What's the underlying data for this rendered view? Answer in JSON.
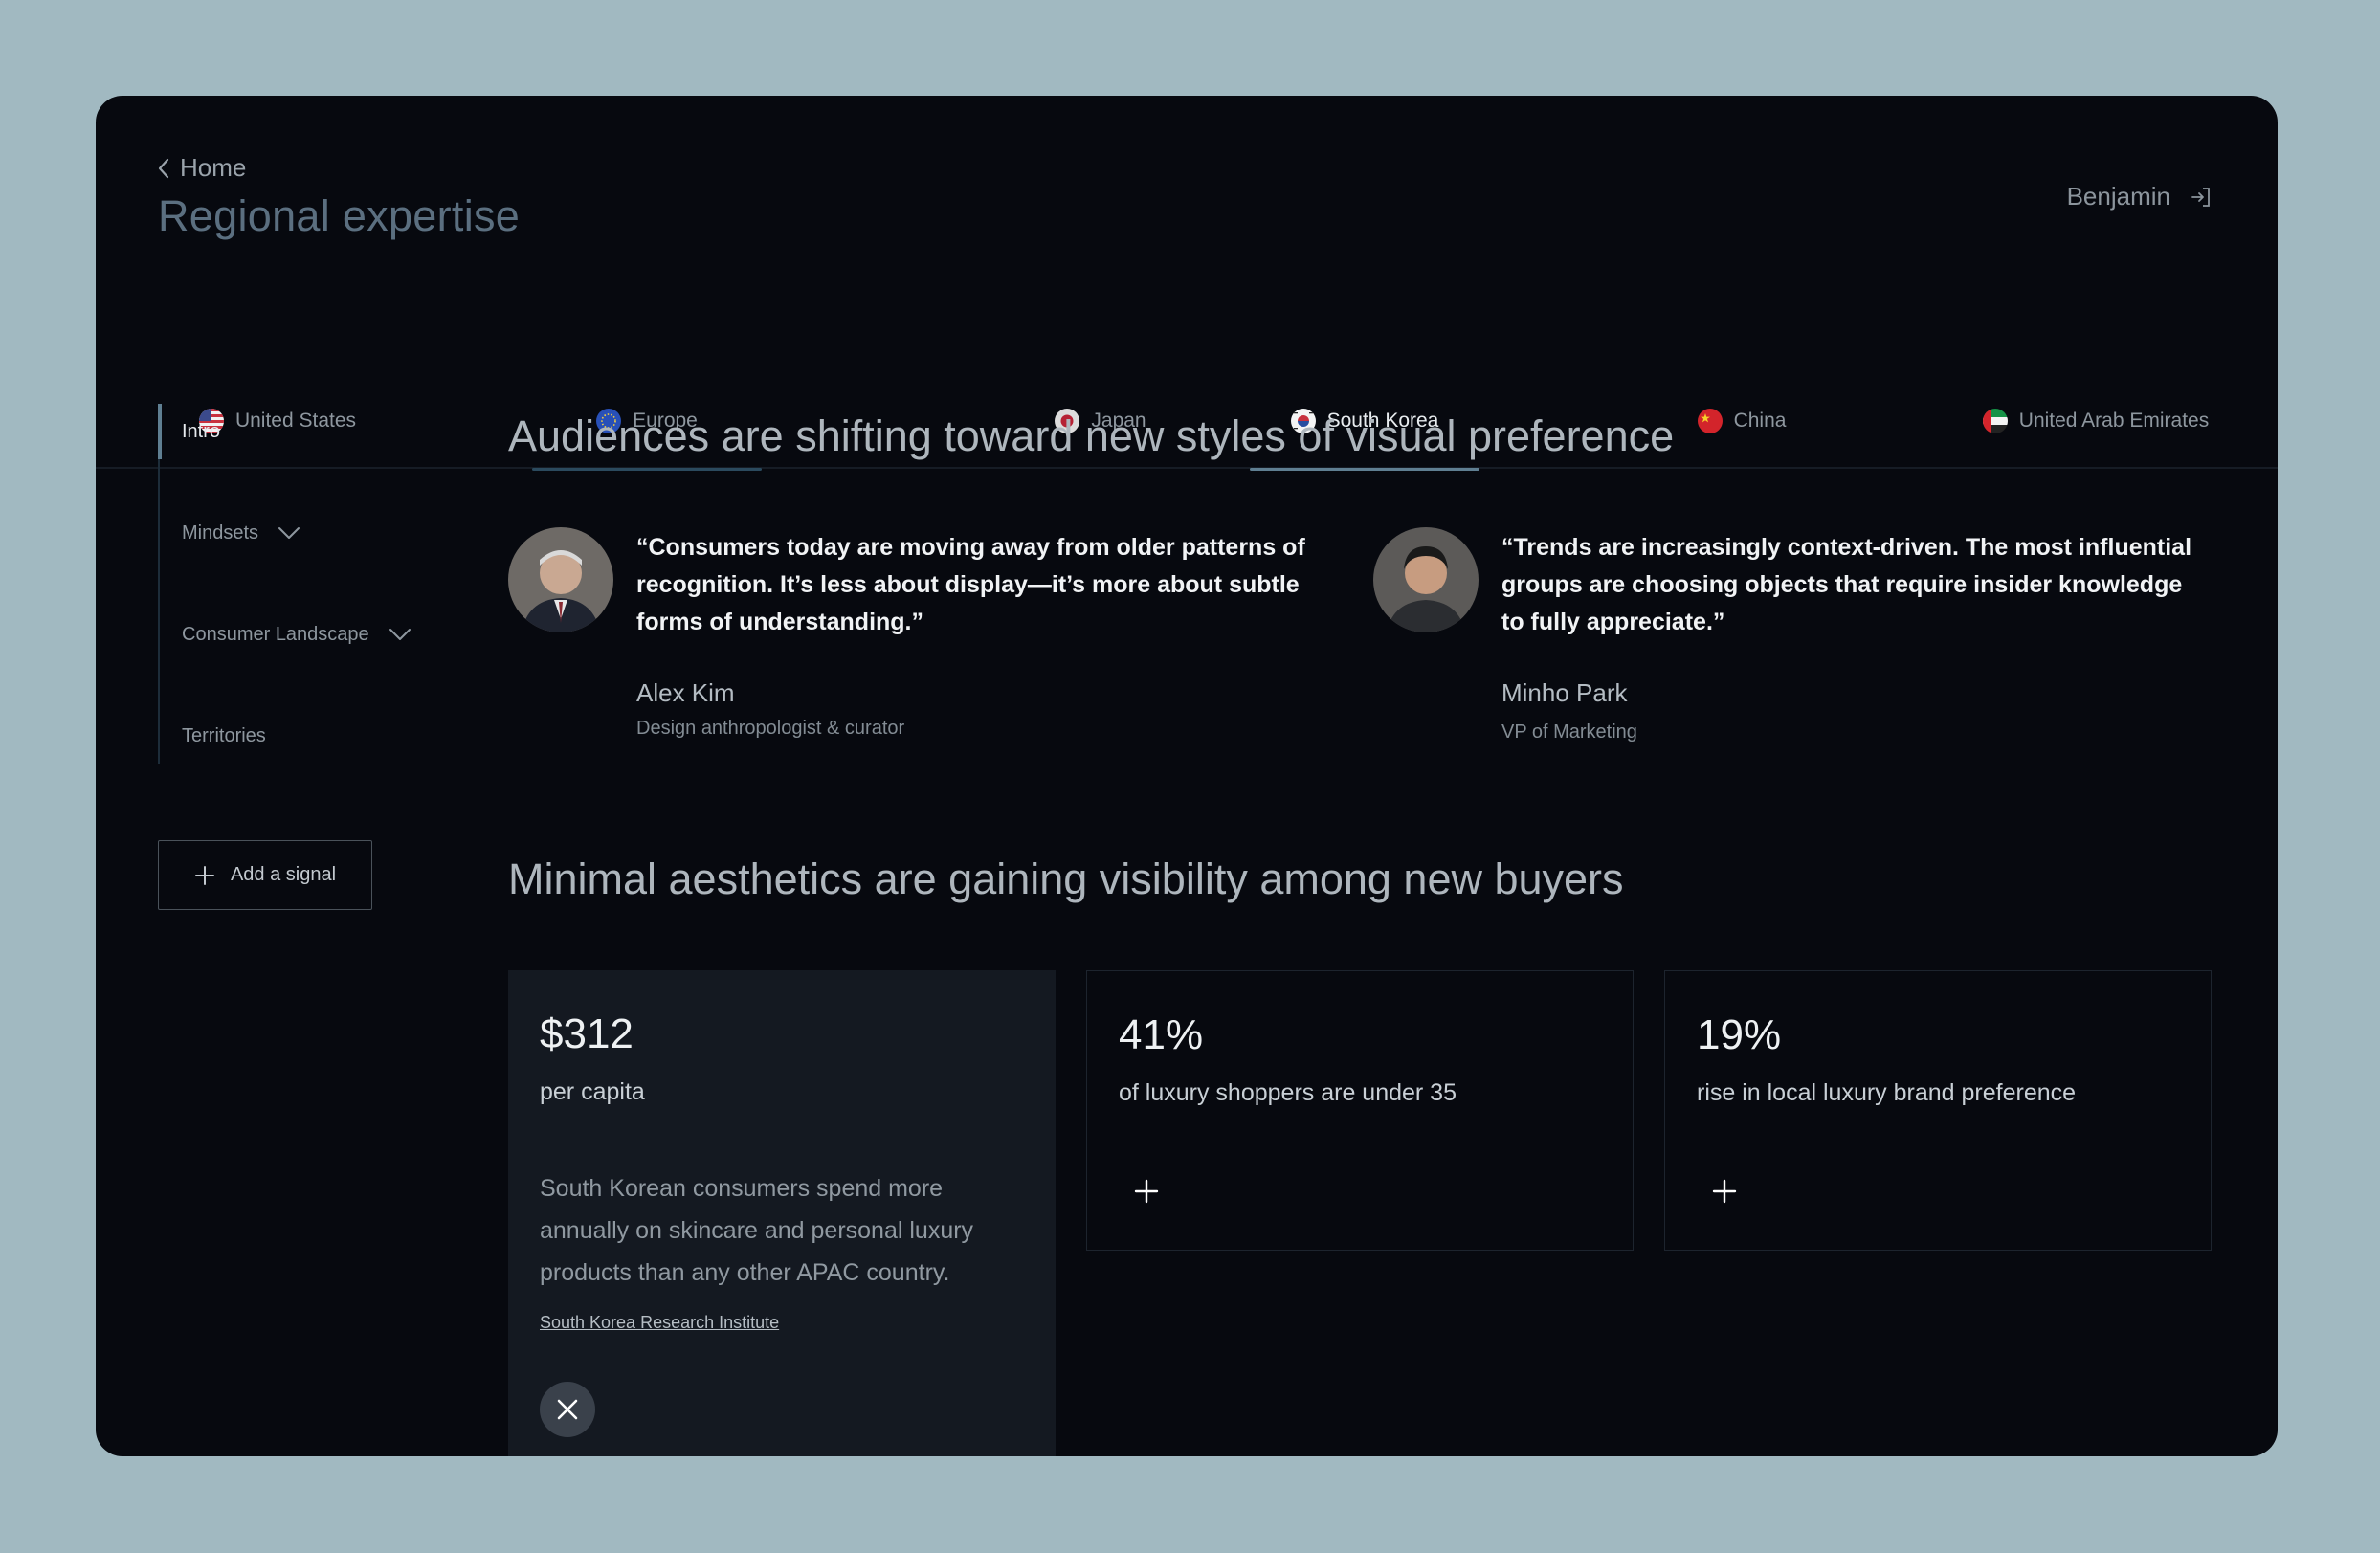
{
  "header": {
    "back_label": "Home",
    "title": "Regional expertise",
    "user_name": "Benjamin"
  },
  "tabs": [
    {
      "label": "United States",
      "flag": "us-flag",
      "active": false
    },
    {
      "label": "Europe",
      "flag": "eu-flag",
      "active": false
    },
    {
      "label": "Japan",
      "flag": "japan-flag",
      "active": false
    },
    {
      "label": "South Korea",
      "flag": "south-korea-flag",
      "active": true
    },
    {
      "label": "China",
      "flag": "china-flag",
      "active": false
    },
    {
      "label": "United Arab Emirates",
      "flag": "uae-flag",
      "active": false
    }
  ],
  "sidebar": {
    "items": [
      {
        "label": "Intro",
        "active": true
      },
      {
        "label": "Mindsets",
        "expandable": true
      },
      {
        "label": "Consumer Landscape",
        "expandable": true
      },
      {
        "label": "Territories"
      }
    ],
    "add_signal_label": "Add a signal"
  },
  "sections": {
    "audiences_title": "Audiences are shifting toward new styles of visual preference",
    "aesthetics_title": "Minimal aesthetics are gaining visibility among new buyers"
  },
  "quotes": [
    {
      "text": "“Consumers today are moving away from older patterns of recognition. It’s less about display—it’s more about subtle forms of understanding.”",
      "name": "Alex Kim",
      "role": "Design anthropologist & curator"
    },
    {
      "text": "“Trends are increasingly context-driven. The most influential groups are choosing objects that require insider knowledge to fully appreciate.”",
      "name": "Minho Park",
      "role": "VP of Marketing"
    }
  ],
  "stats": [
    {
      "value": "$312",
      "label": "per capita",
      "description": "South Korean consumers spend more annually on skincare and personal luxury products than any other APAC country.",
      "source": "South Korea Research Institute",
      "expanded": true
    },
    {
      "value": "41%",
      "label": "of luxury shoppers are under 35",
      "expanded": false
    },
    {
      "value": "19%",
      "label": "rise in local luxury brand preference",
      "expanded": false
    }
  ],
  "colors": {
    "page_bg": "#a1b9c1",
    "window_bg": "#07090f",
    "active_underline": "#5f7f92",
    "title_accent": "#5b6f80",
    "card_bg": "#141921"
  }
}
